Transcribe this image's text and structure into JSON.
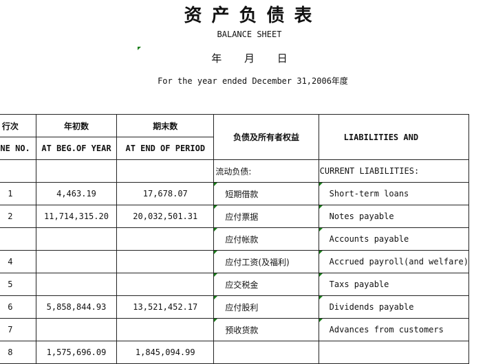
{
  "header": {
    "title_cn": "资产负债表",
    "title_en": "BALANCE  SHEET",
    "date_line": "年  月  日",
    "period": "For the year ended December 31,2006年度"
  },
  "columns": {
    "line_cn": "行次",
    "line_en": "LINE NO.",
    "beg_cn": "年初数",
    "beg_en": "AT BEG.OF YEAR",
    "end_cn": "期末数",
    "end_en": "AT END OF PERIOD",
    "liab_cn": "负债及所有者权益",
    "liab_en": "LIABILITIES AND"
  },
  "rows": [
    {
      "line": "",
      "beg": "",
      "end": "",
      "cn": "流动负债:",
      "en": "CURRENT LIABILITIES:"
    },
    {
      "line": "1",
      "beg": "4,463.19",
      "end": "17,678.07",
      "cn": "短期借款",
      "en": "Short-term loans"
    },
    {
      "line": "2",
      "beg": "11,714,315.20",
      "end": "20,032,501.31",
      "cn": "应付票据",
      "en": "Notes payable"
    },
    {
      "line": "",
      "beg": "",
      "end": "",
      "cn": "应付帐款",
      "en": "Accounts payable"
    },
    {
      "line": "4",
      "beg": "",
      "end": "",
      "cn": "应付工资(及福利)",
      "en": "Accrued payroll(and welfare)"
    },
    {
      "line": "5",
      "beg": "",
      "end": "",
      "cn": "应交税金",
      "en": "Taxs payable"
    },
    {
      "line": "6",
      "beg": "5,858,844.93",
      "end": "13,521,452.17",
      "cn": "应付股利",
      "en": "Dividends payable"
    },
    {
      "line": "7",
      "beg": "",
      "end": "",
      "cn": "预收货款",
      "en": "Advances from customers"
    },
    {
      "line": "8",
      "beg": "1,575,696.09",
      "end": "1,845,094.99",
      "cn": "",
      "en": ""
    }
  ]
}
